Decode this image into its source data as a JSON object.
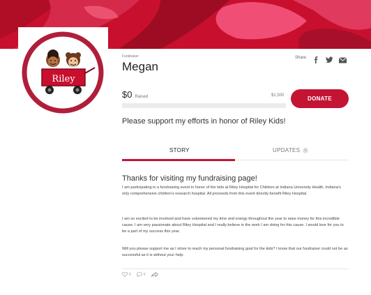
{
  "banner": {
    "colors": [
      "#c8102e",
      "#d62a4a",
      "#f04e74",
      "#9e0c24"
    ]
  },
  "avatar": {
    "logo_text": "Riley"
  },
  "fundraiser": {
    "type_label": "Fundraiser",
    "name": "Megan",
    "raised_amount": "$0",
    "raised_label": "Raised",
    "goal": "$1,500",
    "progress_fraction": 0.0,
    "donate_label": "DONATE",
    "tagline": "Please support my efforts in honor of Riley Kids!"
  },
  "share": {
    "label": "Share",
    "icons": [
      "facebook-icon",
      "twitter-icon",
      "email-icon"
    ]
  },
  "tabs": {
    "story": "STORY",
    "updates": "UPDATES",
    "updates_count": "0"
  },
  "story": {
    "title": "Thanks for visiting my fundraising page!",
    "paragraphs": [
      "I am participating in a fundraising event in honor of the kids at Riley Hospital for Children at Indiana University Health, Indiana's only comprehensive children's research hospital. All proceeds from this event directly benefit Riley Hospital.",
      "I am so excited to be involved and have volunteered my time and energy throughout the year to raise money for this incredible cause. I am very passionate about Riley Hospital and I really believe in the work I am doing for this cause. I would love for you to be a part of my success this year.",
      "Will you please support me as I strive to reach my personal fundraising goal for the kids? I know that our fundraiser could not be as successful as it is without your help."
    ]
  },
  "actions": {
    "likes": "0",
    "comments": "0"
  },
  "colors": {
    "accent": "#c41434",
    "track": "#ececec"
  }
}
